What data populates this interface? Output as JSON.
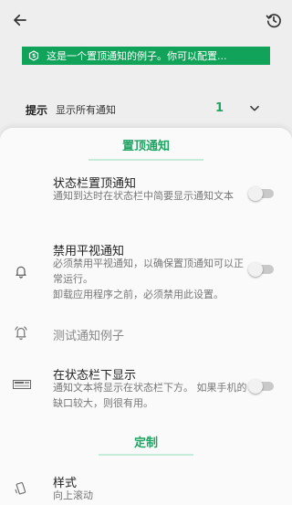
{
  "banner": {
    "text": "这是一个置顶通知的例子。你可以配置..."
  },
  "hint": {
    "label": "提示",
    "value": "显示所有通知",
    "count": "1"
  },
  "sections": {
    "pinned": "置顶通知",
    "custom": "定制"
  },
  "settings": {
    "statusbar_pin": {
      "title": "状态栏置顶通知",
      "desc": "通知到达时在状态栏中简要显示通知文本",
      "enabled": false
    },
    "disable_flat": {
      "title": "禁用平视通知",
      "desc": "必须禁用平视通知，以确保置顶通知可以正常运行。\n卸载应用程序之前，必须禁用此设置。",
      "enabled": false
    },
    "test": {
      "title": "测试通知例子"
    },
    "below_statusbar": {
      "title": "在状态栏下显示",
      "desc": "通知文本将显示在状态栏下方。 如果手机的缺口较大，则很有用。",
      "enabled": false
    },
    "style": {
      "title": "样式",
      "desc": "向上滚动"
    }
  },
  "colors": {
    "accent": "#1fa463",
    "banner": "#12a35a",
    "toggle_off": "#c9c9c9"
  },
  "icons": {
    "back": "arrow-left-icon",
    "history": "history-icon",
    "banner": "s-logo-icon",
    "chevron": "chevron-down-icon",
    "bell": "bell-icon",
    "ring": "bell-ringing-icon",
    "statusbar": "statusbar-icon",
    "style": "phone-tilt-icon"
  }
}
